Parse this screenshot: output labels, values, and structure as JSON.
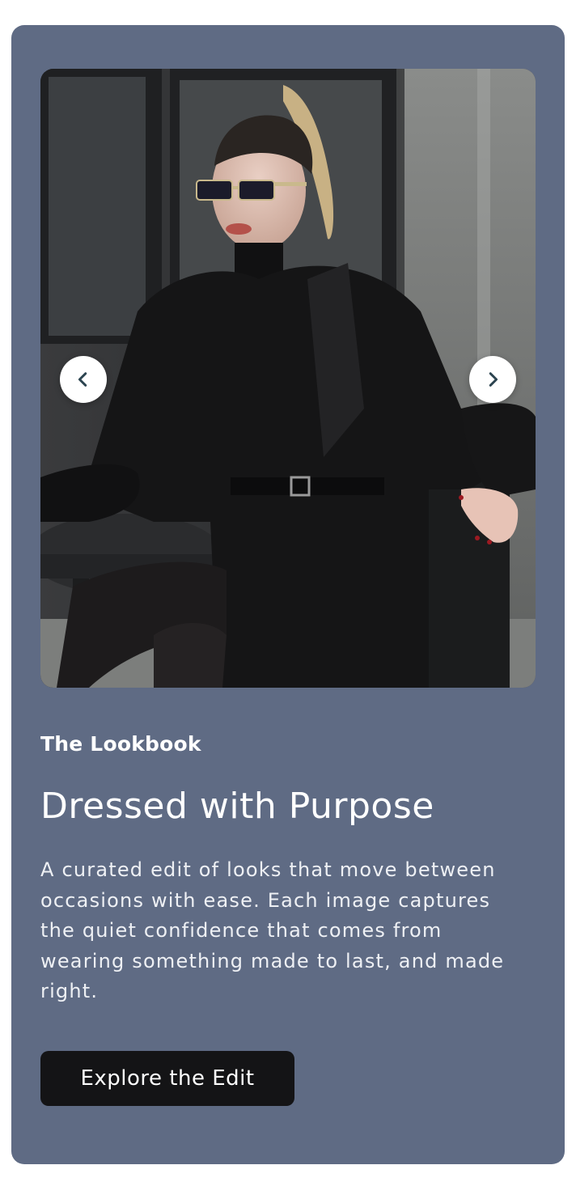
{
  "slider": {
    "image_alt": "Woman in black blazer and sunglasses seated at a cafe table",
    "prev_icon": "chevron-left-icon",
    "next_icon": "chevron-right-icon"
  },
  "content": {
    "eyebrow": "The Lookbook",
    "title": "Dressed with Purpose",
    "description": "A curated edit of looks that move between occasions with ease. Each image captures the quiet confidence that comes from wearing something made to last, and made right.",
    "cta_label": "Explore the Edit"
  },
  "colors": {
    "card_background": "#5f6b84",
    "button_background": "#141416",
    "nav_button_background": "#ffffff",
    "chevron": "#2c4450"
  }
}
